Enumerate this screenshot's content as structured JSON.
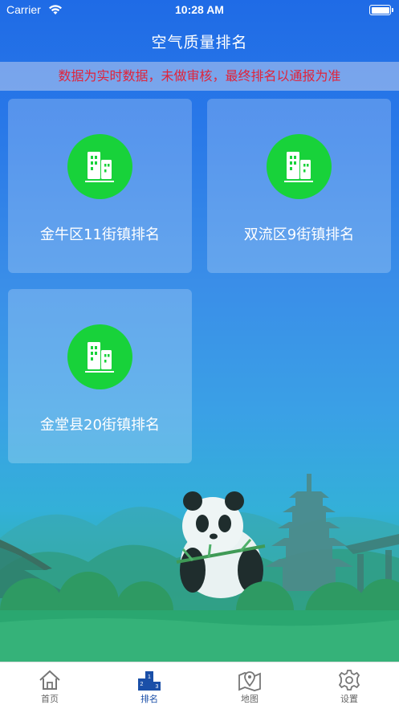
{
  "status": {
    "carrier": "Carrier",
    "time": "10:28 AM"
  },
  "nav": {
    "title": "空气质量排名"
  },
  "notice": {
    "text": "数据为实时数据，未做审核，最终排名以通报为准"
  },
  "cards": [
    {
      "label": "金牛区11街镇排名",
      "icon": "building-icon"
    },
    {
      "label": "双流区9街镇排名",
      "icon": "building-icon"
    },
    {
      "label": "金堂县20街镇排名",
      "icon": "building-icon"
    }
  ],
  "tabs": [
    {
      "label": "首页",
      "icon": "home-icon",
      "active": false
    },
    {
      "label": "排名",
      "icon": "podium-icon",
      "active": true
    },
    {
      "label": "地图",
      "icon": "map-pin-icon",
      "active": false
    },
    {
      "label": "设置",
      "icon": "gear-icon",
      "active": false
    }
  ],
  "colors": {
    "accent": "#1a4fa8",
    "notice_text": "#e0243b",
    "icon_circle": "#18d23a"
  }
}
